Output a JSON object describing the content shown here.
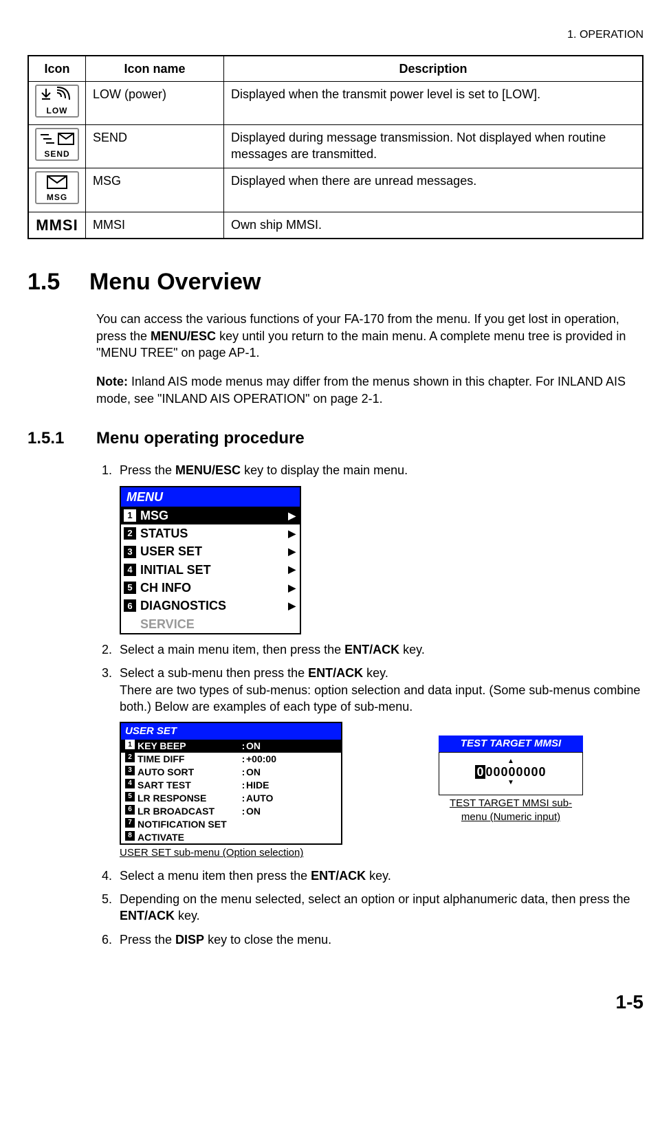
{
  "header": "1.  OPERATION",
  "table": {
    "headers": [
      "Icon",
      "Icon name",
      "Description"
    ],
    "rows": [
      {
        "icon_label": "LOW",
        "name": "LOW (power)",
        "desc": "Displayed when the transmit power level is set to [LOW]."
      },
      {
        "icon_label": "SEND",
        "name": "SEND",
        "desc": "Displayed during message transmission. Not displayed when routine messages are transmitted."
      },
      {
        "icon_label": "MSG",
        "name": "MSG",
        "desc": "Displayed when there are unread messages."
      },
      {
        "icon_label": "MMSI",
        "name": "MMSI",
        "desc": "Own ship MMSI."
      }
    ]
  },
  "section_number": "1.5",
  "section_title": "Menu Overview",
  "overview_p1a": "You can access the various functions of your FA-170 from the menu. If you get lost in operation, press the ",
  "overview_p1b": "MENU/ESC",
  "overview_p1c": " key until you return to the main menu. A complete menu tree is provided in \"MENU TREE\" on page AP-1.",
  "note_label": "Note:",
  "note_text": " Inland AIS mode menus may differ from the menus shown in this chapter. For INLAND AIS mode, see \"INLAND AIS OPERATION\" on page 2-1.",
  "subsection_number": "1.5.1",
  "subsection_title": "Menu operating procedure",
  "steps": {
    "s1a": "Press the ",
    "s1b": "MENU/ESC",
    "s1c": " key to display the main menu.",
    "s2a": "Select a main menu item, then press the ",
    "s2b": "ENT/ACK",
    "s2c": " key.",
    "s3a": "Select a sub-menu then press the ",
    "s3b": "ENT/ACK",
    "s3c": " key.",
    "s3d": "There are two types of sub-menus: option selection and data input. (Some sub-menus combine both.) Below are examples of each type of sub-menu.",
    "s4a": "Select a menu item then press the ",
    "s4b": "ENT/ACK",
    "s4c": " key.",
    "s5a": "Depending on the menu selected, select an option or input alphanumeric data, then press the ",
    "s5b": "ENT/ACK",
    "s5c": " key.",
    "s6a": "Press the ",
    "s6b": "DISP",
    "s6c": " key to close the menu."
  },
  "menu_screen": {
    "title": "MENU",
    "items": [
      {
        "n": "1",
        "label": "MSG",
        "selected": true
      },
      {
        "n": "2",
        "label": "STATUS"
      },
      {
        "n": "3",
        "label": "USER SET"
      },
      {
        "n": "4",
        "label": "INITIAL SET"
      },
      {
        "n": "5",
        "label": "CH INFO"
      },
      {
        "n": "6",
        "label": "DIAGNOSTICS"
      }
    ],
    "disabled": "SERVICE"
  },
  "userset_screen": {
    "title": "USER SET",
    "rows": [
      {
        "n": "1",
        "label": "KEY BEEP",
        "val": "ON",
        "selected": true
      },
      {
        "n": "2",
        "label": "TIME DIFF",
        "val": "+00:00"
      },
      {
        "n": "3",
        "label": "AUTO SORT",
        "val": "ON"
      },
      {
        "n": "4",
        "label": "SART TEST",
        "val": "HIDE"
      },
      {
        "n": "5",
        "label": "LR RESPONSE",
        "val": "AUTO"
      },
      {
        "n": "6",
        "label": "LR BROADCAST",
        "val": "ON"
      },
      {
        "n": "7",
        "label": "NOTIFICATION SET",
        "val": ""
      },
      {
        "n": "8",
        "label": "ACTIVATE",
        "val": ""
      }
    ],
    "caption": "USER SET sub-menu (Option selection)"
  },
  "mmsi_screen": {
    "title": "TEST TARGET MMSI",
    "digit_cursor": "0",
    "digits_rest": "00000000",
    "caption": "TEST TARGET MMSI sub-menu (Numeric input)"
  },
  "page_number": "1-5"
}
